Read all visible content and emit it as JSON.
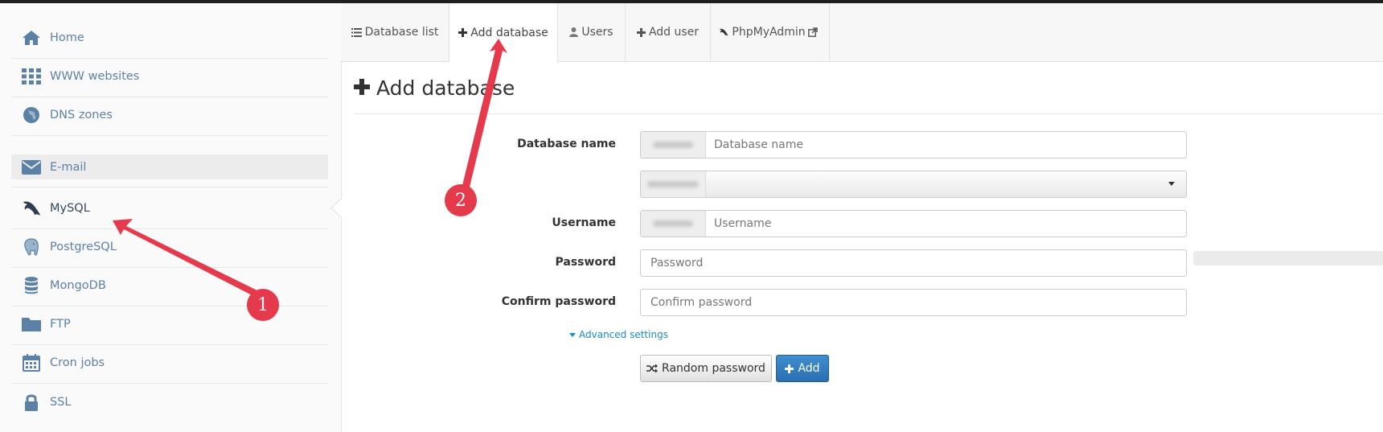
{
  "sidebar": {
    "items": [
      {
        "label": "Home",
        "icon": "home-icon"
      },
      {
        "label": "WWW websites",
        "icon": "grid-icon"
      },
      {
        "label": "DNS zones",
        "icon": "globe-icon"
      },
      {
        "label": "E-mail",
        "icon": "envelope-icon"
      },
      {
        "label": "MySQL",
        "icon": "dolphin-icon"
      },
      {
        "label": "PostgreSQL",
        "icon": "elephant-icon"
      },
      {
        "label": "MongoDB",
        "icon": "database-icon"
      },
      {
        "label": "FTP",
        "icon": "folder-icon"
      },
      {
        "label": "Cron jobs",
        "icon": "calendar-icon"
      },
      {
        "label": "SSL",
        "icon": "lock-icon"
      }
    ],
    "active": "MySQL"
  },
  "tabs": [
    {
      "label": "Database list",
      "icon": "list-icon"
    },
    {
      "label": "Add database",
      "icon": "plus-icon",
      "active": true
    },
    {
      "label": "Users",
      "icon": "user-icon"
    },
    {
      "label": "Add user",
      "icon": "plus-icon"
    },
    {
      "label": "PhpMyAdmin",
      "icon": "external-link-icon"
    }
  ],
  "page": {
    "title": "Add database"
  },
  "form": {
    "database_name_label": "Database name",
    "database_name_placeholder": "Database name",
    "username_label": "Username",
    "username_placeholder": "Username",
    "password_label": "Password",
    "password_placeholder": "Password",
    "confirm_label": "Confirm password",
    "confirm_placeholder": "Confirm password",
    "advanced_label": "Advanced settings",
    "random_button": "Random password",
    "add_button": "Add"
  },
  "annotations": [
    {
      "number": "1",
      "target": "MySQL"
    },
    {
      "number": "2",
      "target": "Add database"
    }
  ],
  "colors": {
    "accent": "#2a6eb0",
    "link": "#1a8bc6",
    "sidebar_text": "#5b82a6",
    "annotation": "#e53a4c"
  }
}
